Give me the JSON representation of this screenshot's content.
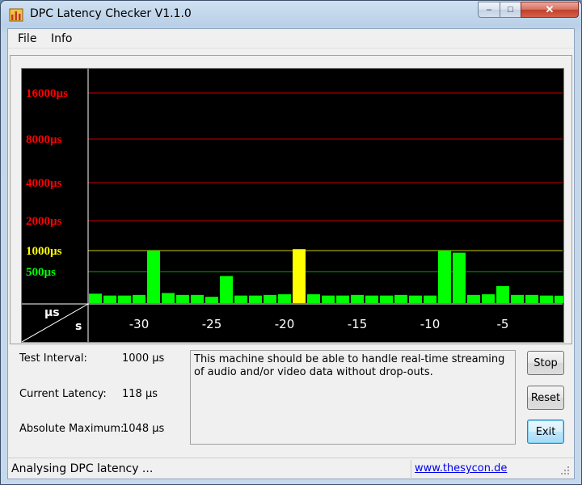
{
  "window": {
    "title": "DPC Latency Checker V1.1.0",
    "controls": {
      "minimize": "–",
      "maximize": "□",
      "close": "✕"
    }
  },
  "menu": {
    "items": [
      "File",
      "Info"
    ]
  },
  "chart_data": {
    "type": "bar",
    "y_scale": "log-like (labeled thresholds)",
    "y_tick_labels": [
      {
        "label": "16000µs",
        "value": 16000,
        "color": "#ff0000"
      },
      {
        "label": "8000µs",
        "value": 8000,
        "color": "#ff0000"
      },
      {
        "label": "4000µs",
        "value": 4000,
        "color": "#ff0000"
      },
      {
        "label": "2000µs",
        "value": 2000,
        "color": "#ff0000"
      },
      {
        "label": "1000µs",
        "value": 1000,
        "color": "#ffff00"
      },
      {
        "label": "500µs",
        "value": 500,
        "color": "#00ff00"
      }
    ],
    "x_tick_labels": [
      "-30",
      "-25",
      "-20",
      "-15",
      "-10",
      "-5"
    ],
    "x_ticks": [
      -30,
      -25,
      -20,
      -15,
      -10,
      -5
    ],
    "corner_labels": {
      "y_unit": "µs",
      "x_unit": "s"
    },
    "x": [
      -33,
      -32,
      -31,
      -30,
      -29,
      -28,
      -27,
      -26,
      -25,
      -24,
      -23,
      -22,
      -21,
      -20,
      -19,
      -18,
      -17,
      -16,
      -15,
      -14,
      -13,
      -12,
      -11,
      -10,
      -9,
      -8,
      -7,
      -6,
      -5,
      -4,
      -3,
      -2,
      -1
    ],
    "values": [
      150,
      120,
      120,
      130,
      1000,
      160,
      130,
      130,
      100,
      430,
      120,
      120,
      130,
      140,
      1048,
      140,
      120,
      120,
      130,
      120,
      120,
      130,
      120,
      120,
      1000,
      950,
      130,
      140,
      270,
      130,
      130,
      120,
      118
    ],
    "bar_colors": {
      "ok": "#00ff00",
      "warning": "#ffff00"
    },
    "grid_colors": {
      "red": "#cc0000",
      "yellow": "#cccc00",
      "green": "#00aa00"
    },
    "background": "#000000"
  },
  "stats": {
    "test_interval_label": "Test Interval:",
    "test_interval_value": "1000 µs",
    "current_latency_label": "Current Latency:",
    "current_latency_value": "118 µs",
    "absolute_maximum_label": "Absolute Maximum:",
    "absolute_maximum_value": "1048 µs"
  },
  "message": "This machine should be able to handle real-time streaming of audio and/or video data without drop-outs.",
  "buttons": {
    "stop": "Stop",
    "reset": "Reset",
    "exit": "Exit"
  },
  "status": {
    "text": "Analysing DPC latency ...",
    "link": "www.thesycon.de"
  }
}
